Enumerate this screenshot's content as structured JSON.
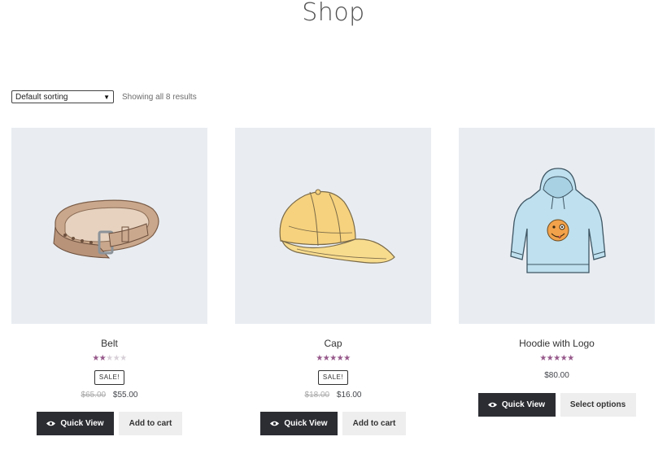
{
  "page": {
    "title": "Shop"
  },
  "toolbar": {
    "sort_selected": "Default sorting",
    "result_count": "Showing all 8 results"
  },
  "products": [
    {
      "name": "Belt",
      "rating": 2,
      "rating_max": 5,
      "sale_badge": "SALE!",
      "old_price": "$65.00",
      "price": "$55.00",
      "quick_view": "Quick View",
      "action": "Add to cart"
    },
    {
      "name": "Cap",
      "rating": 5,
      "rating_max": 5,
      "sale_badge": "SALE!",
      "old_price": "$18.00",
      "price": "$16.00",
      "quick_view": "Quick View",
      "action": "Add to cart"
    },
    {
      "name": "Hoodie with Logo",
      "rating": 5,
      "rating_max": 5,
      "price": "$80.00",
      "quick_view": "Quick View",
      "action": "Select options"
    }
  ],
  "colors": {
    "star_on": "#96588a",
    "star_off": "#d8d0d8",
    "thumb_bg": "#e9edf2",
    "button_dark": "#2c2d33",
    "button_light": "#eeeeee"
  },
  "icons": {
    "sort_arrow": "triangle-down-icon",
    "quick_view": "eye-icon"
  }
}
